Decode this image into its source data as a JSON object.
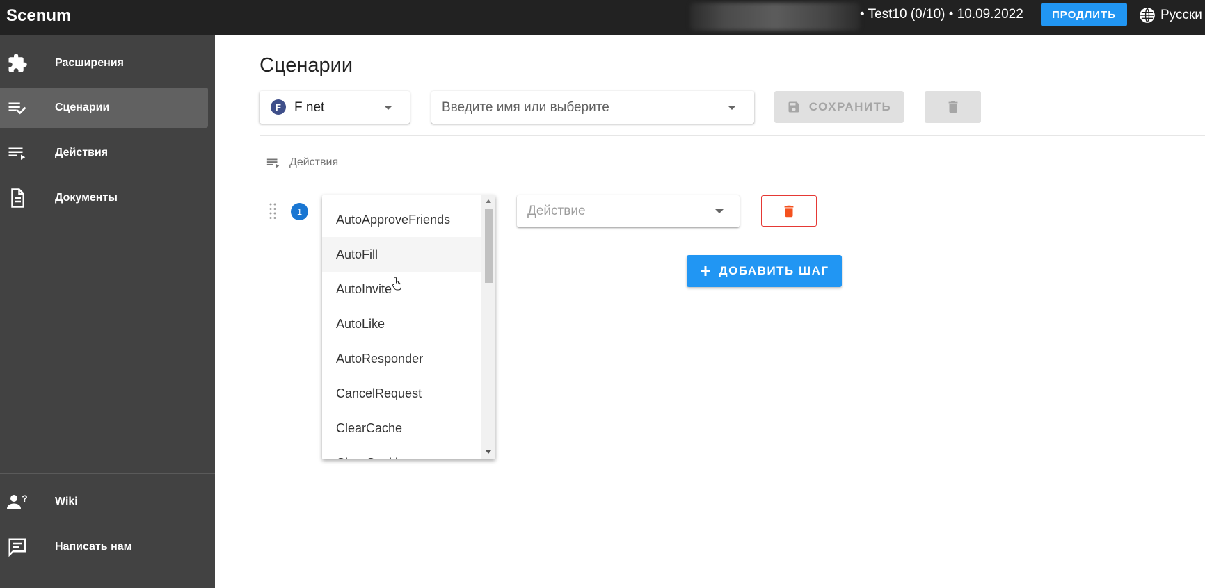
{
  "app": {
    "logo": "Scenum"
  },
  "topbar": {
    "account_info": "• Test10 (0/10) • 10.09.2022",
    "extend_label": "ПРОДЛИТЬ",
    "language": "Русски"
  },
  "sidebar": {
    "items": [
      {
        "label": "Расширения",
        "icon": "puzzle-icon",
        "active": false
      },
      {
        "label": "Сценарии",
        "icon": "playlist-check-icon",
        "active": true
      },
      {
        "label": "Действия",
        "icon": "playlist-play-icon",
        "active": false
      },
      {
        "label": "Документы",
        "icon": "document-icon",
        "active": false
      }
    ],
    "bottom_items": [
      {
        "label": "Wiki",
        "icon": "person-question-icon"
      },
      {
        "label": "Написать нам",
        "icon": "message-icon"
      }
    ]
  },
  "main": {
    "title": "Сценарии",
    "account_select": {
      "value": "F net",
      "avatar_letter": "F"
    },
    "scenario_select": {
      "placeholder": "Введите имя или выберите"
    },
    "save_label": "СОХРАНИТЬ",
    "actions_label": "Действия",
    "step": {
      "number": "1",
      "action_placeholder": "Действие"
    },
    "add_step_label": "ДОБАВИТЬ ШАГ",
    "dropdown_options": [
      "AutoApproveFriends",
      "AutoFill",
      "AutoInvite",
      "AutoLike",
      "AutoResponder",
      "CancelRequest",
      "ClearCache",
      "ClearCookies"
    ],
    "hovered_option": "AutoFill"
  },
  "colors": {
    "topbar": "#222222",
    "sidebar": "#424242",
    "sidebar_active": "#616161",
    "primary": "#2196f3",
    "danger": "#e53935",
    "step_badge": "#1976d2"
  }
}
